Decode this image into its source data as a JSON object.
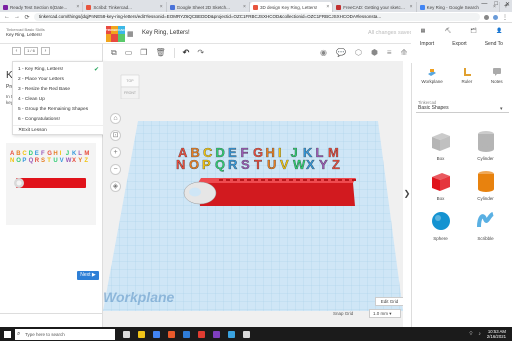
{
  "browser": {
    "tabs": [
      {
        "title": "Ready Test Section 6(Date...",
        "color": "#7a1fa2",
        "active": false
      },
      {
        "title": "Scribd: Tinkercad...",
        "color": "#e8553e",
        "active": false
      },
      {
        "title": "Google Sheet 2D Sketch...",
        "color": "#4a72d9",
        "active": false
      },
      {
        "title": "3D design Key Ring, Letters!",
        "color": "#e8553e",
        "active": true
      },
      {
        "title": "FreeCAD: Getting your sketches",
        "color": "#c23030",
        "active": false
      },
      {
        "title": "Key Ring - Google Search",
        "color": "#4285f4",
        "active": false
      }
    ],
    "new_tab": "+",
    "window_controls": [
      "—",
      "□",
      "✕"
    ],
    "url": "tinkercad.com/things/jdqjPnNE58-key-ring-letters/edit?lessonid=EOMRYZ6QCBEDDD&projectid=OZC1FRBCJSXHCOD&collectionid=OZC1FRBCJSXHCODA#lessonsta..."
  },
  "header": {
    "crumb_top": "Tinkercad Basic Skills",
    "crumb_bottom": "Key Ring, Letters!",
    "logo_letters": [
      "TIN",
      "KER",
      "CAD",
      "",
      "",
      ""
    ],
    "logo_colors": [
      "#e94a3f",
      "#f1a51d",
      "#3cb8e6",
      "#f1a51d",
      "#e94a3f",
      "#59c96a"
    ],
    "design_name": "Key Ring, Letters!",
    "save_status": "All changes saved",
    "right_top": [
      "▦",
      "⛏",
      "🗂",
      "👤"
    ],
    "right_buttons": [
      "Import",
      "Export",
      "Send To"
    ]
  },
  "toolbar": {
    "undo": "↶",
    "redo": "↷",
    "right": [
      "◉",
      "💬",
      "⬡",
      "⬢",
      "≡",
      "⟰"
    ]
  },
  "lesson_panel": {
    "title": "Ke",
    "subtitle": "Pro",
    "sub2_lines": [
      "In th",
      "key"
    ],
    "pager": "1 / 6",
    "menu": [
      {
        "label": "1 - Key Ring, Letters!",
        "done": true
      },
      {
        "label": "2 - Place Your Letters",
        "done": false
      },
      {
        "label": "3 - Resize the Red Base",
        "done": false
      },
      {
        "label": "4 - Clean Up",
        "done": false
      },
      {
        "label": "5 - Group the Remaining Shapes",
        "done": false
      },
      {
        "label": "6 - Congratulations!",
        "done": false
      },
      {
        "label": "Exit Lesson",
        "done": false,
        "exit": true
      }
    ],
    "next_label": "Next ▶"
  },
  "workplane": {
    "viewcube_top": "TOP",
    "viewcube_front": "FRONT",
    "label": "Workplane",
    "edit_grid": "Edit Grid",
    "snap_grid_label": "Snap Grid",
    "snap_value": "1.0 mm ▾",
    "letters_row1": "ABCDEFGHIJKLM",
    "letters_row2": "NOPQRSTUVWXYZ",
    "letter_colors": [
      "#e74c3c",
      "#e67e22",
      "#f1c40f",
      "#2ecc71",
      "#3498db",
      "#9b59b6"
    ]
  },
  "right_panel": {
    "views": [
      "Workplane",
      "Ruler",
      "Notes"
    ],
    "category_label": "Tinkercad",
    "category_value": "Basic Shapes",
    "shapes": [
      {
        "name": "Box",
        "color": "#b5b5b5"
      },
      {
        "name": "Cylinder",
        "color": "#b5b5b5"
      },
      {
        "name": "Box",
        "color": "#e0131b"
      },
      {
        "name": "Cylinder",
        "color": "#e8820e"
      },
      {
        "name": "Sphere",
        "color": "#1493d1"
      },
      {
        "name": "Scribble",
        "color": "#5ab0e3"
      }
    ],
    "collapse": "❯"
  },
  "taskbar": {
    "search_placeholder": "Type here to search",
    "time": "10:53 AM",
    "date": "2/16/2021",
    "app_colors": [
      "#dcdcdc",
      "#f0c419",
      "#4285f4",
      "#e85a2b",
      "#2f7dd8",
      "#e03c31",
      "#7f3fbf",
      "#3aa3e0",
      "#d9d9d9"
    ]
  }
}
